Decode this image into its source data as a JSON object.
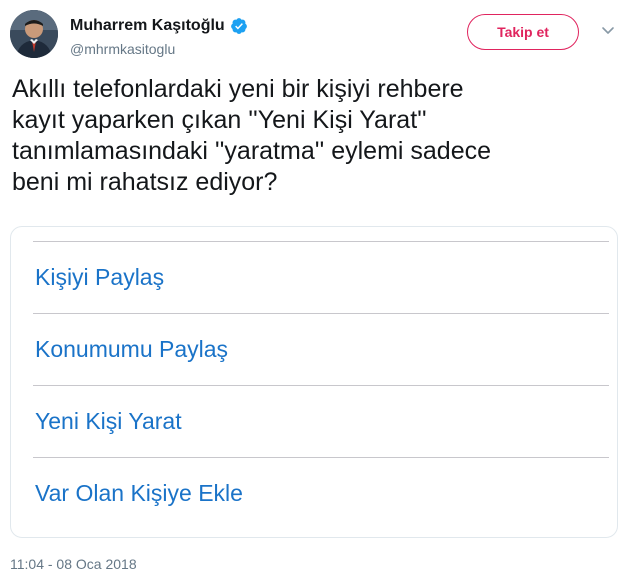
{
  "author": {
    "display_name": "Muharrem Kaşıtoğlu",
    "handle": "@mhrmkasitoglu",
    "verified": true
  },
  "follow_button": {
    "label": "Takip et"
  },
  "tweet": {
    "text_lines": [
      "Akıllı telefonlardaki yeni bir kişiyi rehbere",
      "kayıt yaparken çıkan ''Yeni Kişi Yarat''",
      "tanımlamasındaki ''yaratma'' eylemi sadece",
      "beni mi rahatsız ediyor?"
    ],
    "timestamp": "11:04 - 08 Oca 2018"
  },
  "attached_image": {
    "actions": [
      "Kişiyi Paylaş",
      "Konumumu Paylaş",
      "Yeni Kişi Yarat",
      "Var Olan Kişiye Ekle"
    ]
  },
  "colors": {
    "follow_accent": "#e0245e",
    "ios_link_blue": "#1a73c8",
    "verified_blue": "#1da1f2",
    "muted_text": "#657786"
  },
  "icons": [
    "verified-badge-icon",
    "chevron-down-icon"
  ]
}
